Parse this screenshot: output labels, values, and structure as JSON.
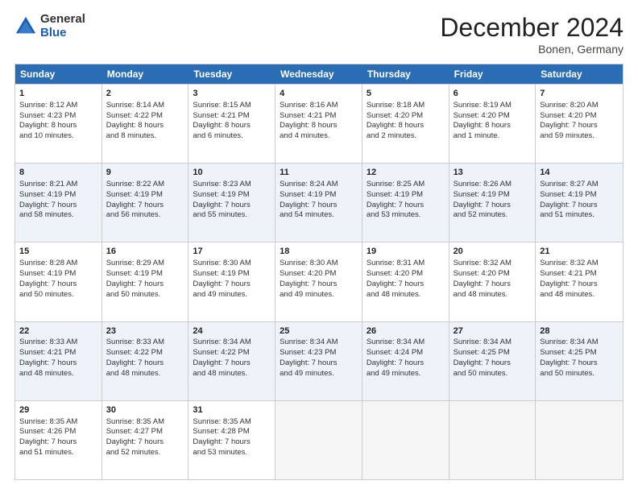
{
  "logo": {
    "general": "General",
    "blue": "Blue"
  },
  "title": "December 2024",
  "location": "Bonen, Germany",
  "header_days": [
    "Sunday",
    "Monday",
    "Tuesday",
    "Wednesday",
    "Thursday",
    "Friday",
    "Saturday"
  ],
  "rows": [
    {
      "alt": false,
      "cells": [
        {
          "day": "1",
          "lines": [
            "Sunrise: 8:12 AM",
            "Sunset: 4:23 PM",
            "Daylight: 8 hours",
            "and 10 minutes."
          ]
        },
        {
          "day": "2",
          "lines": [
            "Sunrise: 8:14 AM",
            "Sunset: 4:22 PM",
            "Daylight: 8 hours",
            "and 8 minutes."
          ]
        },
        {
          "day": "3",
          "lines": [
            "Sunrise: 8:15 AM",
            "Sunset: 4:21 PM",
            "Daylight: 8 hours",
            "and 6 minutes."
          ]
        },
        {
          "day": "4",
          "lines": [
            "Sunrise: 8:16 AM",
            "Sunset: 4:21 PM",
            "Daylight: 8 hours",
            "and 4 minutes."
          ]
        },
        {
          "day": "5",
          "lines": [
            "Sunrise: 8:18 AM",
            "Sunset: 4:20 PM",
            "Daylight: 8 hours",
            "and 2 minutes."
          ]
        },
        {
          "day": "6",
          "lines": [
            "Sunrise: 8:19 AM",
            "Sunset: 4:20 PM",
            "Daylight: 8 hours",
            "and 1 minute."
          ]
        },
        {
          "day": "7",
          "lines": [
            "Sunrise: 8:20 AM",
            "Sunset: 4:20 PM",
            "Daylight: 7 hours",
            "and 59 minutes."
          ]
        }
      ]
    },
    {
      "alt": true,
      "cells": [
        {
          "day": "8",
          "lines": [
            "Sunrise: 8:21 AM",
            "Sunset: 4:19 PM",
            "Daylight: 7 hours",
            "and 58 minutes."
          ]
        },
        {
          "day": "9",
          "lines": [
            "Sunrise: 8:22 AM",
            "Sunset: 4:19 PM",
            "Daylight: 7 hours",
            "and 56 minutes."
          ]
        },
        {
          "day": "10",
          "lines": [
            "Sunrise: 8:23 AM",
            "Sunset: 4:19 PM",
            "Daylight: 7 hours",
            "and 55 minutes."
          ]
        },
        {
          "day": "11",
          "lines": [
            "Sunrise: 8:24 AM",
            "Sunset: 4:19 PM",
            "Daylight: 7 hours",
            "and 54 minutes."
          ]
        },
        {
          "day": "12",
          "lines": [
            "Sunrise: 8:25 AM",
            "Sunset: 4:19 PM",
            "Daylight: 7 hours",
            "and 53 minutes."
          ]
        },
        {
          "day": "13",
          "lines": [
            "Sunrise: 8:26 AM",
            "Sunset: 4:19 PM",
            "Daylight: 7 hours",
            "and 52 minutes."
          ]
        },
        {
          "day": "14",
          "lines": [
            "Sunrise: 8:27 AM",
            "Sunset: 4:19 PM",
            "Daylight: 7 hours",
            "and 51 minutes."
          ]
        }
      ]
    },
    {
      "alt": false,
      "cells": [
        {
          "day": "15",
          "lines": [
            "Sunrise: 8:28 AM",
            "Sunset: 4:19 PM",
            "Daylight: 7 hours",
            "and 50 minutes."
          ]
        },
        {
          "day": "16",
          "lines": [
            "Sunrise: 8:29 AM",
            "Sunset: 4:19 PM",
            "Daylight: 7 hours",
            "and 50 minutes."
          ]
        },
        {
          "day": "17",
          "lines": [
            "Sunrise: 8:30 AM",
            "Sunset: 4:19 PM",
            "Daylight: 7 hours",
            "and 49 minutes."
          ]
        },
        {
          "day": "18",
          "lines": [
            "Sunrise: 8:30 AM",
            "Sunset: 4:20 PM",
            "Daylight: 7 hours",
            "and 49 minutes."
          ]
        },
        {
          "day": "19",
          "lines": [
            "Sunrise: 8:31 AM",
            "Sunset: 4:20 PM",
            "Daylight: 7 hours",
            "and 48 minutes."
          ]
        },
        {
          "day": "20",
          "lines": [
            "Sunrise: 8:32 AM",
            "Sunset: 4:20 PM",
            "Daylight: 7 hours",
            "and 48 minutes."
          ]
        },
        {
          "day": "21",
          "lines": [
            "Sunrise: 8:32 AM",
            "Sunset: 4:21 PM",
            "Daylight: 7 hours",
            "and 48 minutes."
          ]
        }
      ]
    },
    {
      "alt": true,
      "cells": [
        {
          "day": "22",
          "lines": [
            "Sunrise: 8:33 AM",
            "Sunset: 4:21 PM",
            "Daylight: 7 hours",
            "and 48 minutes."
          ]
        },
        {
          "day": "23",
          "lines": [
            "Sunrise: 8:33 AM",
            "Sunset: 4:22 PM",
            "Daylight: 7 hours",
            "and 48 minutes."
          ]
        },
        {
          "day": "24",
          "lines": [
            "Sunrise: 8:34 AM",
            "Sunset: 4:22 PM",
            "Daylight: 7 hours",
            "and 48 minutes."
          ]
        },
        {
          "day": "25",
          "lines": [
            "Sunrise: 8:34 AM",
            "Sunset: 4:23 PM",
            "Daylight: 7 hours",
            "and 49 minutes."
          ]
        },
        {
          "day": "26",
          "lines": [
            "Sunrise: 8:34 AM",
            "Sunset: 4:24 PM",
            "Daylight: 7 hours",
            "and 49 minutes."
          ]
        },
        {
          "day": "27",
          "lines": [
            "Sunrise: 8:34 AM",
            "Sunset: 4:25 PM",
            "Daylight: 7 hours",
            "and 50 minutes."
          ]
        },
        {
          "day": "28",
          "lines": [
            "Sunrise: 8:34 AM",
            "Sunset: 4:25 PM",
            "Daylight: 7 hours",
            "and 50 minutes."
          ]
        }
      ]
    },
    {
      "alt": false,
      "cells": [
        {
          "day": "29",
          "lines": [
            "Sunrise: 8:35 AM",
            "Sunset: 4:26 PM",
            "Daylight: 7 hours",
            "and 51 minutes."
          ]
        },
        {
          "day": "30",
          "lines": [
            "Sunrise: 8:35 AM",
            "Sunset: 4:27 PM",
            "Daylight: 7 hours",
            "and 52 minutes."
          ]
        },
        {
          "day": "31",
          "lines": [
            "Sunrise: 8:35 AM",
            "Sunset: 4:28 PM",
            "Daylight: 7 hours",
            "and 53 minutes."
          ]
        },
        {
          "day": "",
          "lines": []
        },
        {
          "day": "",
          "lines": []
        },
        {
          "day": "",
          "lines": []
        },
        {
          "day": "",
          "lines": []
        }
      ]
    }
  ]
}
